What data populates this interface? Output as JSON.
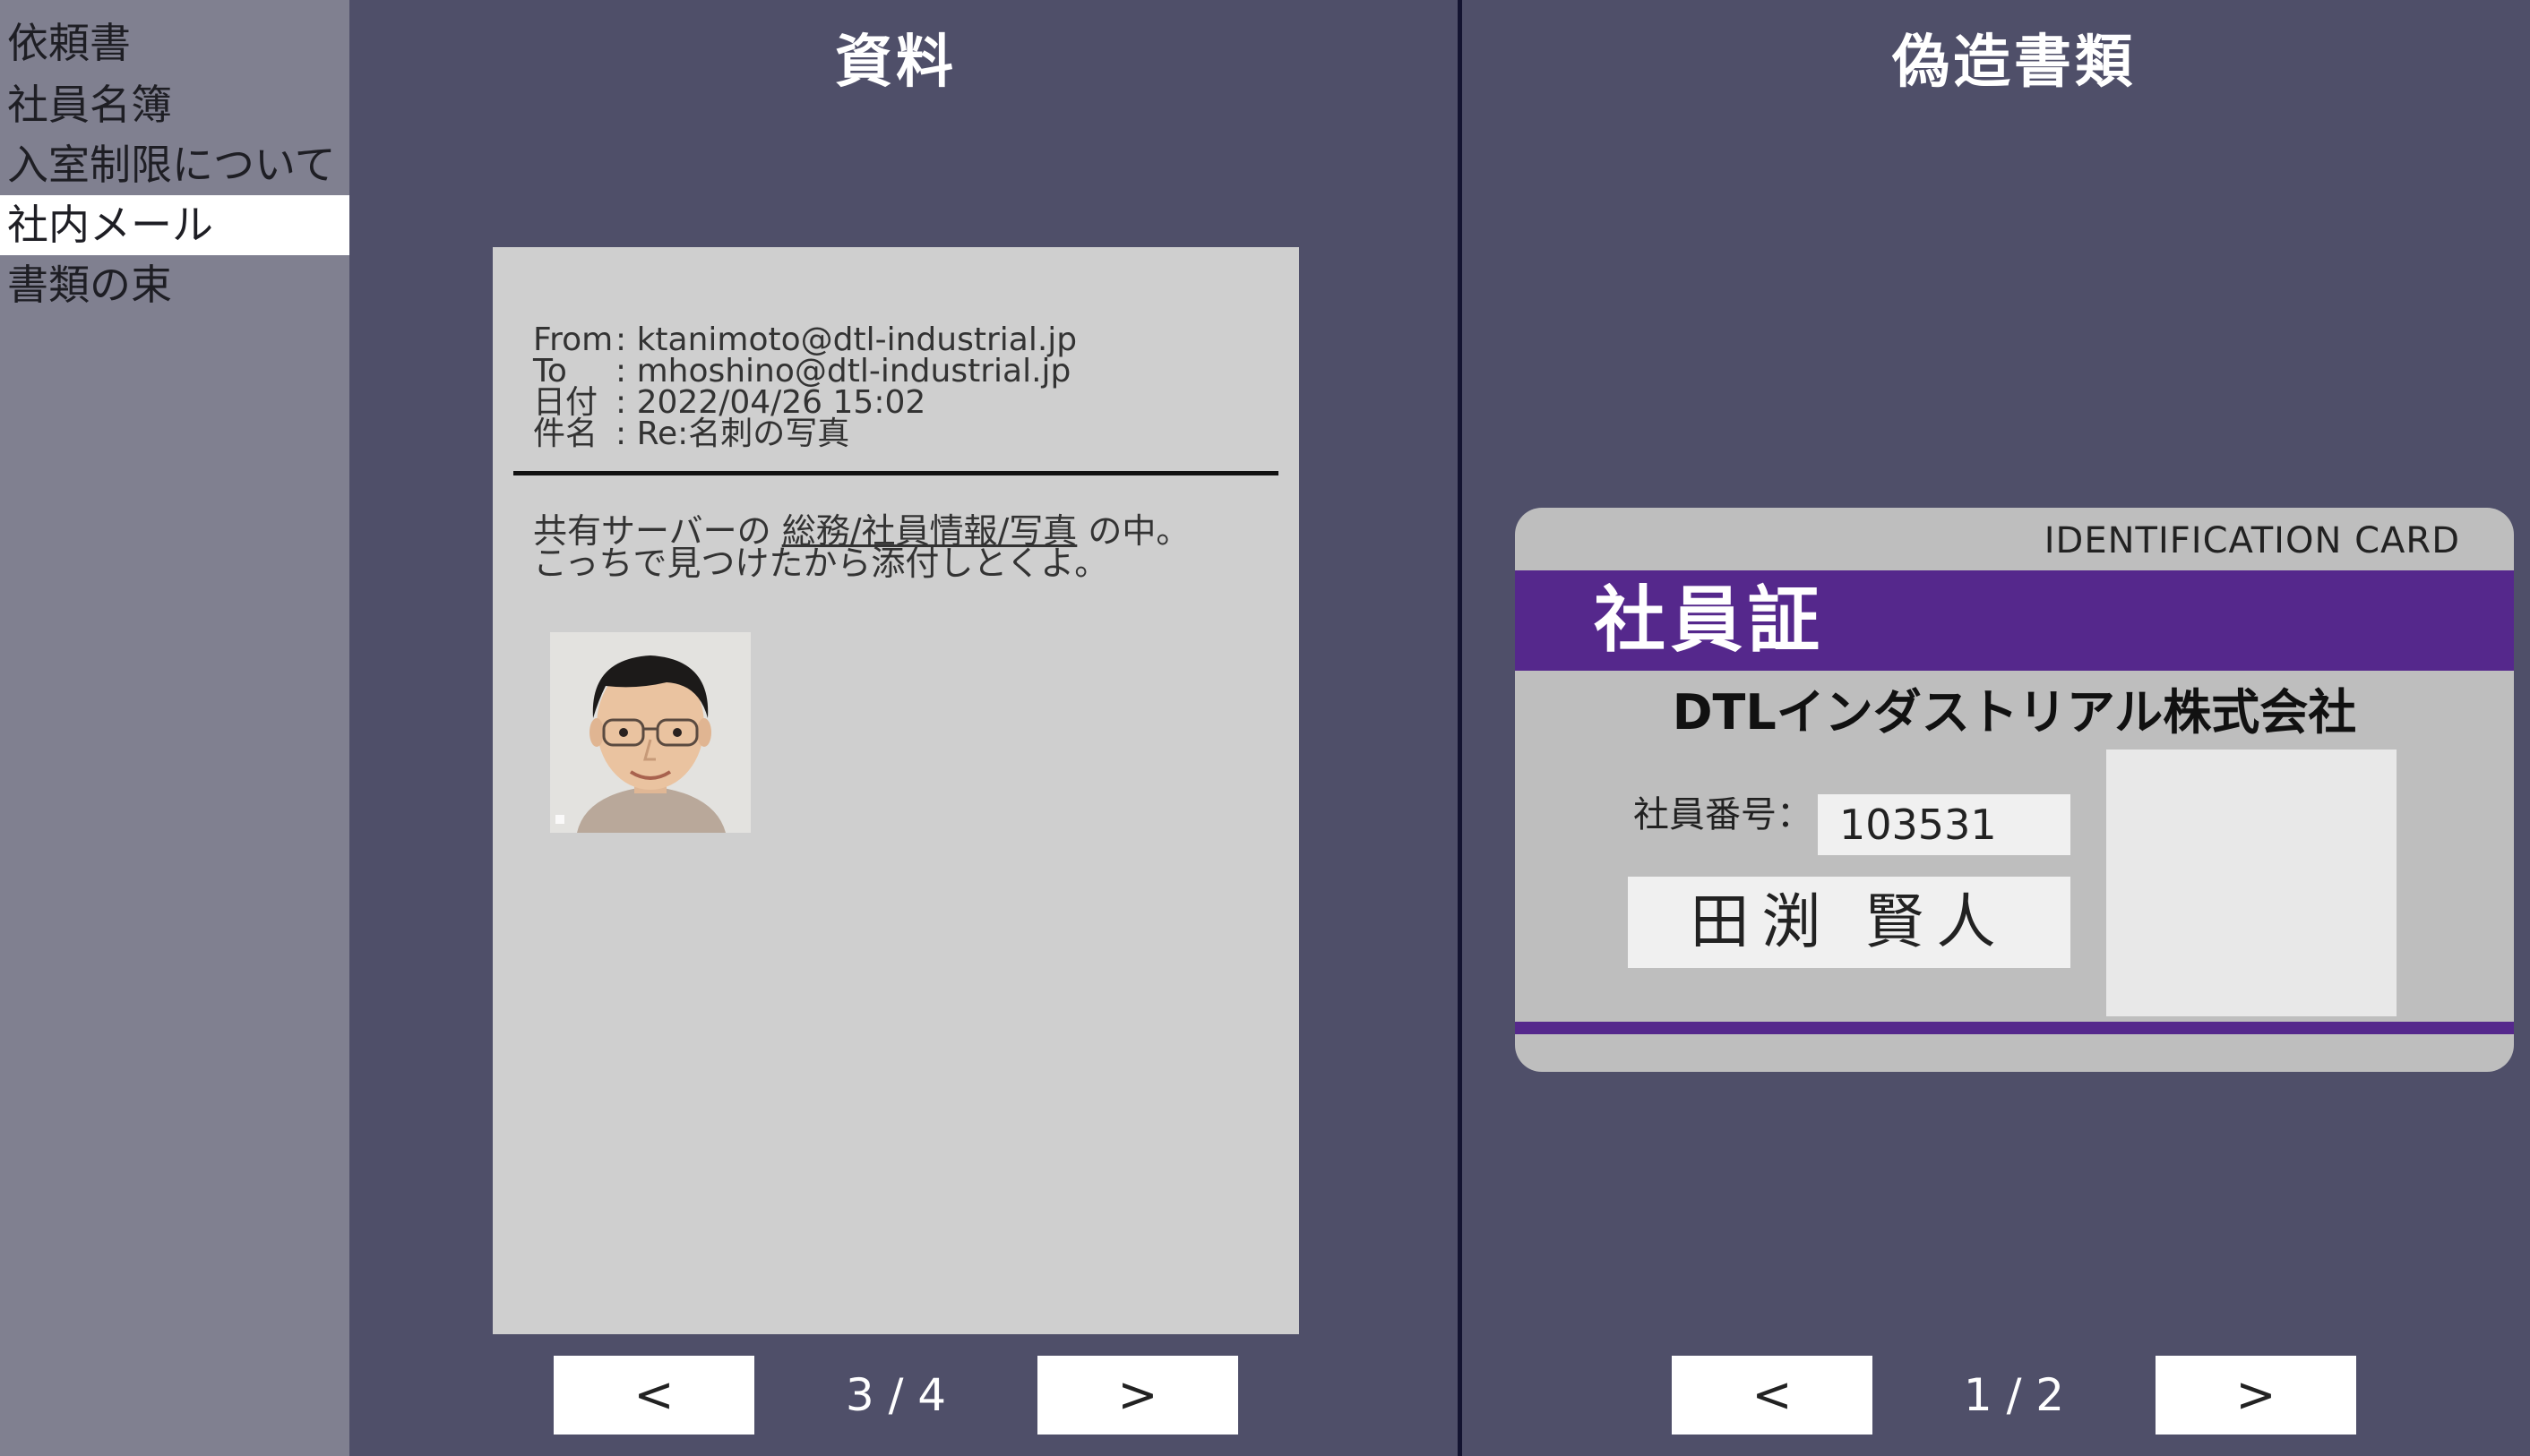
{
  "sidebar": {
    "items": [
      {
        "label": "依頼書"
      },
      {
        "label": "社員名簿"
      },
      {
        "label": "入室制限について"
      },
      {
        "label": "社内メール",
        "active": true
      },
      {
        "label": "書類の束"
      }
    ]
  },
  "left_panel": {
    "title": "資料",
    "email": {
      "from_key": "From",
      "from": ": ktanimoto@dtl-industrial.jp",
      "to_key": "To",
      "to": ": mhoshino@dtl-industrial.jp",
      "date_key": "日付",
      "date": ": 2022/04/26 15:02",
      "subject_key": "件名",
      "subject": ": Re:名刺の写真",
      "body_prefix": "共有サーバーの ",
      "body_link": "総務/社員情報/写真",
      "body_suffix": " の中。",
      "body_line2": "こっちで見つけたから添付しとくよ。"
    },
    "prev_label": "<",
    "next_label": ">",
    "page": "3 / 4"
  },
  "right_panel": {
    "title": "偽造書類",
    "card": {
      "id_label": "IDENTIFICATION  CARD",
      "title": "社員証",
      "company": "DTLインダストリアル株式会社",
      "number_label": "社員番号：",
      "number": "103531",
      "name": "田渕 賢人"
    },
    "prev_label": "<",
    "next_label": ">",
    "page": "1 / 2"
  },
  "colors": {
    "background": "#4f4f69",
    "sidebar": "#808090",
    "card_accent": "#55288c"
  }
}
